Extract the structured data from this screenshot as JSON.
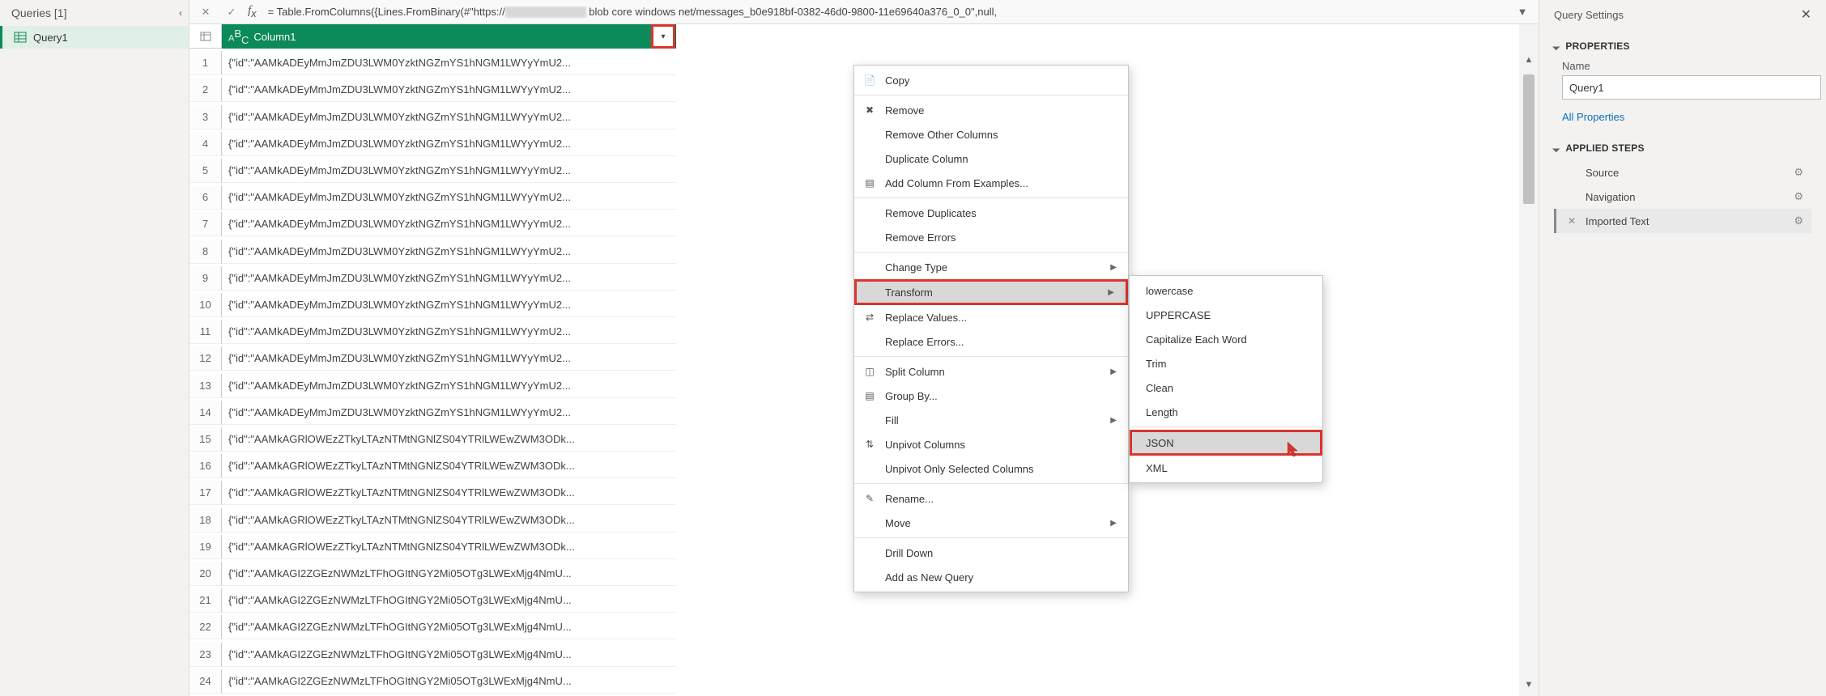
{
  "queries_pane": {
    "title": "Queries [1]",
    "items": [
      "Query1"
    ]
  },
  "formula_bar": {
    "prefix": "= Table.FromColumns({Lines.FromBinary(#\"https://",
    "suffix": " blob core windows net/messages_b0e918bf-0382-46d0-9800-11e69640a376_0_0\",null,"
  },
  "grid": {
    "column_header": "Column1",
    "rows": [
      "{\"id\":\"AAMkADEyMmJmZDU3LWM0YzktNGZmYS1hNGM1LWYyYmU2...",
      "{\"id\":\"AAMkADEyMmJmZDU3LWM0YzktNGZmYS1hNGM1LWYyYmU2...",
      "{\"id\":\"AAMkADEyMmJmZDU3LWM0YzktNGZmYS1hNGM1LWYyYmU2...",
      "{\"id\":\"AAMkADEyMmJmZDU3LWM0YzktNGZmYS1hNGM1LWYyYmU2...",
      "{\"id\":\"AAMkADEyMmJmZDU3LWM0YzktNGZmYS1hNGM1LWYyYmU2...",
      "{\"id\":\"AAMkADEyMmJmZDU3LWM0YzktNGZmYS1hNGM1LWYyYmU2...",
      "{\"id\":\"AAMkADEyMmJmZDU3LWM0YzktNGZmYS1hNGM1LWYyYmU2...",
      "{\"id\":\"AAMkADEyMmJmZDU3LWM0YzktNGZmYS1hNGM1LWYyYmU2...",
      "{\"id\":\"AAMkADEyMmJmZDU3LWM0YzktNGZmYS1hNGM1LWYyYmU2...",
      "{\"id\":\"AAMkADEyMmJmZDU3LWM0YzktNGZmYS1hNGM1LWYyYmU2...",
      "{\"id\":\"AAMkADEyMmJmZDU3LWM0YzktNGZmYS1hNGM1LWYyYmU2...",
      "{\"id\":\"AAMkADEyMmJmZDU3LWM0YzktNGZmYS1hNGM1LWYyYmU2...",
      "{\"id\":\"AAMkADEyMmJmZDU3LWM0YzktNGZmYS1hNGM1LWYyYmU2...",
      "{\"id\":\"AAMkADEyMmJmZDU3LWM0YzktNGZmYS1hNGM1LWYyYmU2...",
      "{\"id\":\"AAMkAGRlOWEzZTkyLTAzNTMtNGNlZS04YTRlLWEwZWM3ODk...",
      "{\"id\":\"AAMkAGRlOWEzZTkyLTAzNTMtNGNlZS04YTRlLWEwZWM3ODk...",
      "{\"id\":\"AAMkAGRlOWEzZTkyLTAzNTMtNGNlZS04YTRlLWEwZWM3ODk...",
      "{\"id\":\"AAMkAGRlOWEzZTkyLTAzNTMtNGNlZS04YTRlLWEwZWM3ODk...",
      "{\"id\":\"AAMkAGRlOWEzZTkyLTAzNTMtNGNlZS04YTRlLWEwZWM3ODk...",
      "{\"id\":\"AAMkAGI2ZGEzNWMzLTFhOGItNGY2Mi05OTg3LWExMjg4NmU...",
      "{\"id\":\"AAMkAGI2ZGEzNWMzLTFhOGItNGY2Mi05OTg3LWExMjg4NmU...",
      "{\"id\":\"AAMkAGI2ZGEzNWMzLTFhOGItNGY2Mi05OTg3LWExMjg4NmU...",
      "{\"id\":\"AAMkAGI2ZGEzNWMzLTFhOGItNGY2Mi05OTg3LWExMjg4NmU...",
      "{\"id\":\"AAMkAGI2ZGEzNWMzLTFhOGItNGY2Mi05OTg3LWExMjg4NmU..."
    ]
  },
  "context_menu": {
    "copy": "Copy",
    "remove": "Remove",
    "remove_other": "Remove Other Columns",
    "duplicate": "Duplicate Column",
    "add_examples": "Add Column From Examples...",
    "remove_dup": "Remove Duplicates",
    "remove_err": "Remove Errors",
    "change_type": "Change Type",
    "transform": "Transform",
    "replace_values": "Replace Values...",
    "replace_errors": "Replace Errors...",
    "split_column": "Split Column",
    "group_by": "Group By...",
    "fill": "Fill",
    "unpivot": "Unpivot Columns",
    "unpivot_selected": "Unpivot Only Selected Columns",
    "rename": "Rename...",
    "move": "Move",
    "drill_down": "Drill Down",
    "add_query": "Add as New Query"
  },
  "submenu": {
    "lowercase": "lowercase",
    "uppercase": "UPPERCASE",
    "capitalize": "Capitalize Each Word",
    "trim": "Trim",
    "clean": "Clean",
    "length": "Length",
    "json": "JSON",
    "xml": "XML"
  },
  "settings": {
    "title": "Query Settings",
    "properties_title": "PROPERTIES",
    "name_label": "Name",
    "name_value": "Query1",
    "all_properties": "All Properties",
    "applied_steps_title": "APPLIED STEPS",
    "steps": [
      {
        "label": "Source",
        "gear": true
      },
      {
        "label": "Navigation",
        "gear": true
      },
      {
        "label": "Imported Text",
        "selected": true,
        "delete": true,
        "gear": true
      }
    ]
  }
}
